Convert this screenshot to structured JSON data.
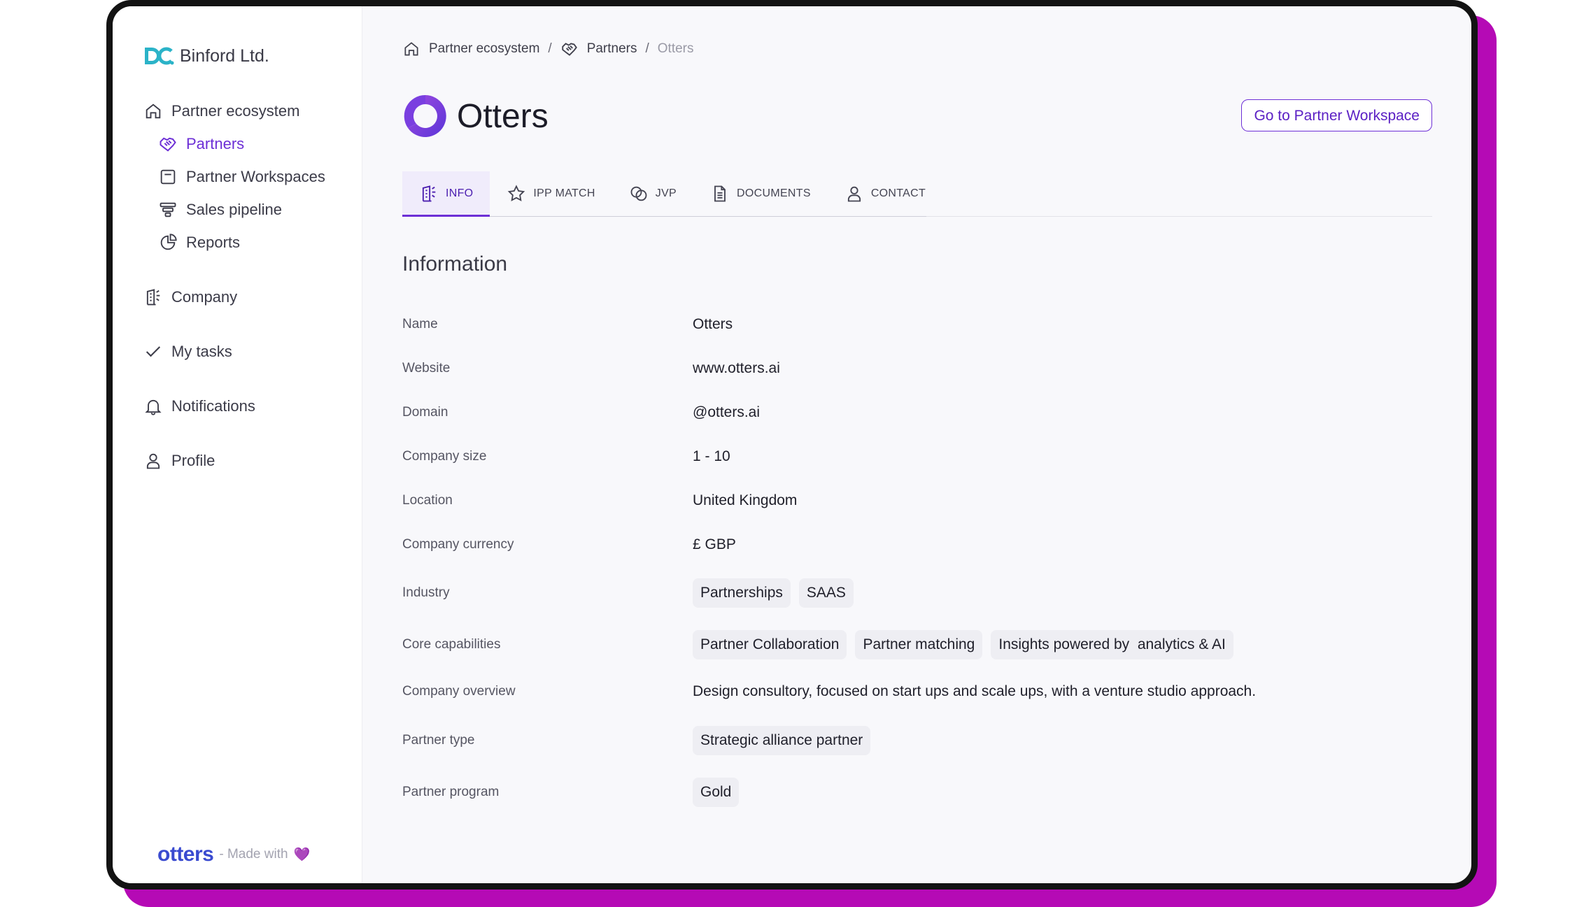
{
  "brand": {
    "name": "Binford Ltd."
  },
  "sidebar": {
    "items": [
      {
        "label": "Partner ecosystem",
        "icon": "home-icon"
      },
      {
        "label": "Partners",
        "icon": "handshake-icon",
        "active": true
      },
      {
        "label": "Partner Workspaces",
        "icon": "workspace-icon"
      },
      {
        "label": "Sales pipeline",
        "icon": "funnel-icon"
      },
      {
        "label": "Reports",
        "icon": "pie-chart-icon"
      },
      {
        "label": "Company",
        "icon": "building-icon"
      },
      {
        "label": "My tasks",
        "icon": "check-icon"
      },
      {
        "label": "Notifications",
        "icon": "bell-icon"
      },
      {
        "label": "Profile",
        "icon": "user-icon"
      }
    ],
    "footer": {
      "logo_text": "otters",
      "made_with": "- Made with",
      "heart": "💜"
    }
  },
  "breadcrumb": {
    "items": [
      "Partner ecosystem",
      "Partners",
      "Otters"
    ],
    "separator": "/"
  },
  "header": {
    "title": "Otters",
    "button_label": "Go to Partner Workspace"
  },
  "tabs": [
    {
      "label": "INFO",
      "icon": "building-icon",
      "active": true
    },
    {
      "label": "IPP MATCH",
      "icon": "star-icon"
    },
    {
      "label": "JVP",
      "icon": "overlap-circles-icon"
    },
    {
      "label": "DOCUMENTS",
      "icon": "document-icon"
    },
    {
      "label": "CONTACT",
      "icon": "user-icon"
    }
  ],
  "info": {
    "section_title": "Information",
    "rows": {
      "name": {
        "label": "Name",
        "value": "Otters"
      },
      "website": {
        "label": "Website",
        "value": "www.otters.ai"
      },
      "domain": {
        "label": "Domain",
        "value": "@otters.ai"
      },
      "company_size": {
        "label": "Company size",
        "value": "1 - 10"
      },
      "location": {
        "label": "Location",
        "value": "United Kingdom"
      },
      "currency": {
        "label": "Company currency",
        "value": "£ GBP"
      },
      "industry": {
        "label": "Industry",
        "chips": [
          "Partnerships",
          "SAAS"
        ]
      },
      "core_capabilities": {
        "label": "Core capabilities",
        "chips": [
          "Partner Collaboration",
          "Partner matching",
          "Insights powered by  analytics & AI"
        ]
      },
      "overview": {
        "label": "Company overview",
        "value": "Design consultory, focused on start ups and scale ups, with a venture studio approach."
      },
      "partner_type": {
        "label": "Partner type",
        "chips": [
          "Strategic alliance partner"
        ]
      },
      "partner_program": {
        "label": "Partner program",
        "chips": [
          "Gold"
        ]
      }
    }
  },
  "colors": {
    "accent": "#6d2fd6",
    "frame_shadow": "#b50ab5",
    "brand_teal": "#2bb3c8",
    "footer_logo": "#3a4bd0"
  }
}
